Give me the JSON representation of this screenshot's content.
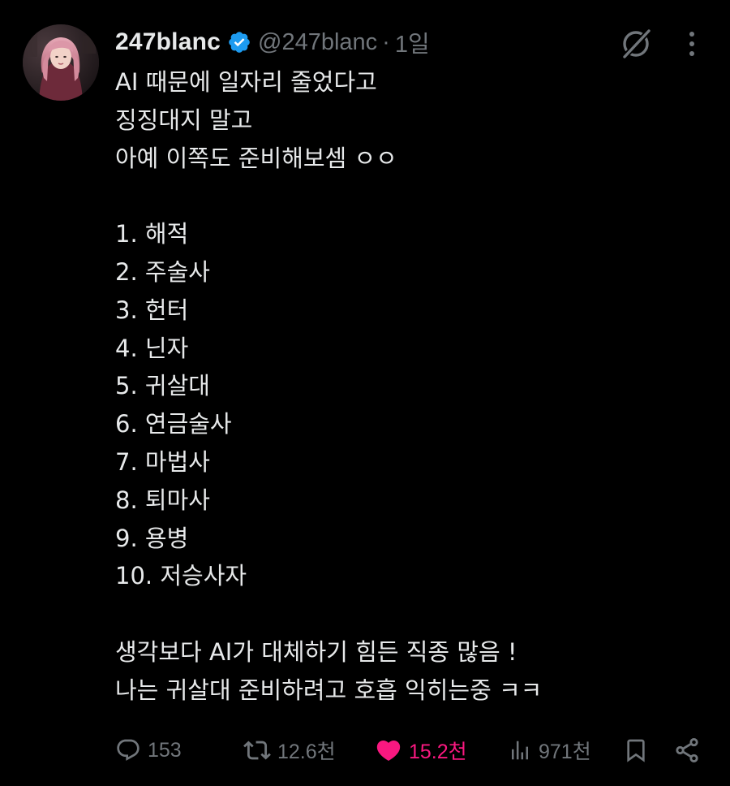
{
  "tweet": {
    "display_name": "247blanc",
    "handle": "@247blanc",
    "separator": "·",
    "time": "1일",
    "avatar_icon": "avatar-image",
    "verified_icon": "verified-badge-icon",
    "verified_color": "#1d9bf0",
    "lines": [
      "AI 때문에 일자리 줄었다고",
      "징징대지 말고",
      "아예 이쪽도 준비해보셈 ㅇㅇ",
      "",
      "1. 해적",
      "2. 주술사",
      "3. 헌터",
      "4. 닌자",
      "5. 귀살대",
      "6. 연금술사",
      "7. 마법사",
      "8. 퇴마사",
      "9. 용병",
      "10. 저승사자",
      "",
      "생각보다 AI가 대체하기 힘든 직종 많음 !",
      "나는 귀살대 준비하려고 호흡 익히는중 ㅋㅋ"
    ]
  },
  "actions": {
    "reply": {
      "icon": "reply-icon",
      "count": "153"
    },
    "retweet": {
      "icon": "retweet-icon",
      "count": "12.6천"
    },
    "like": {
      "icon": "heart-icon",
      "count": "15.2천",
      "active": true,
      "color": "#f91880"
    },
    "views": {
      "icon": "views-icon",
      "count": "971천"
    },
    "bookmark": {
      "icon": "bookmark-icon"
    },
    "share": {
      "icon": "share-icon"
    }
  },
  "header_icons": {
    "grok": "grok-icon",
    "more": "more-icon"
  },
  "colors": {
    "background": "#000000",
    "text": "#e7e9ea",
    "secondary": "#71767b"
  }
}
